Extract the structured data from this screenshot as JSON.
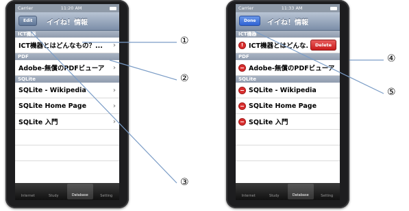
{
  "left_phone": {
    "status": {
      "carrier": "Carrier",
      "time": "11:20 AM"
    },
    "nav": {
      "title": "イイね！情報",
      "button": "Edit"
    },
    "sections": [
      {
        "header": "ICT機器",
        "rows": [
          "ICT機器とはどんなもの？..."
        ]
      },
      {
        "header": "PDF",
        "rows": [
          "Adobe-無償のPDFビューア"
        ]
      },
      {
        "header": "SQLite",
        "rows": [
          "SQLite - Wikipedia",
          "SQLite Home Page",
          "SQLite 入門"
        ]
      }
    ],
    "tabs": [
      "Internet",
      "Study",
      "Database",
      "Setting"
    ],
    "active_tab": "Database"
  },
  "right_phone": {
    "status": {
      "carrier": "Carrier",
      "time": "11:33 AM"
    },
    "nav": {
      "title": "イイね！情報",
      "button": "Done"
    },
    "sections": [
      {
        "header": "ICT機器",
        "rows": [
          "ICT機器とはどんな..."
        ]
      },
      {
        "header": "PDF",
        "rows": [
          "Adobe-無償のPDFビューア"
        ]
      },
      {
        "header": "SQLite",
        "rows": [
          "SQLite - Wikipedia",
          "SQLite Home Page",
          "SQLite 入門"
        ]
      }
    ],
    "delete_label": "Delete",
    "tabs": [
      "Internet",
      "Study",
      "Database",
      "Setting"
    ],
    "active_tab": "Database"
  },
  "callouts": [
    "①",
    "②",
    "③",
    "④",
    "⑤"
  ],
  "colors": {
    "annotation_line": "#7a9cc6",
    "delete": "#c91d1d",
    "done": "#2f63d4"
  }
}
